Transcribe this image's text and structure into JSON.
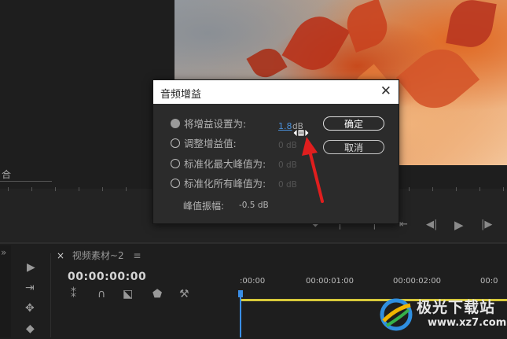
{
  "monitor": {
    "zoom_select_label": "合"
  },
  "dialog": {
    "title": "音频增益",
    "close_glyph": "✕",
    "options": [
      {
        "label": "将增益设置为:",
        "value": "1.8",
        "unit": "dB",
        "selected": true
      },
      {
        "label": "调整增益值:",
        "value": "0 dB",
        "unit": "",
        "selected": false
      },
      {
        "label": "标准化最大峰值为:",
        "value": "0 dB",
        "unit": "",
        "selected": false
      },
      {
        "label": "标准化所有峰值为:",
        "value": "0 dB",
        "unit": "",
        "selected": false
      }
    ],
    "peak_label": "峰值振幅:",
    "peak_value": "-0.5 dB",
    "ok_label": "确定",
    "cancel_label": "取消"
  },
  "timeline": {
    "tab_close": "×",
    "sequence_name": "视频素材~2",
    "menu_glyph": "≡",
    "timecode": "00:00:00:00",
    "ruler_labels": [
      ":00:00",
      "00:00:01:00",
      "00:00:02:00",
      "00:0"
    ],
    "panel_arrow": "»"
  },
  "watermark": {
    "text": "极光下载站",
    "url": "www.xz7.com"
  },
  "colors": {
    "accent": "#4a90d9",
    "annotation_arrow": "#e01e1e",
    "playhead": "#3a8ee6",
    "work_area_bar": "#d8c93a"
  }
}
